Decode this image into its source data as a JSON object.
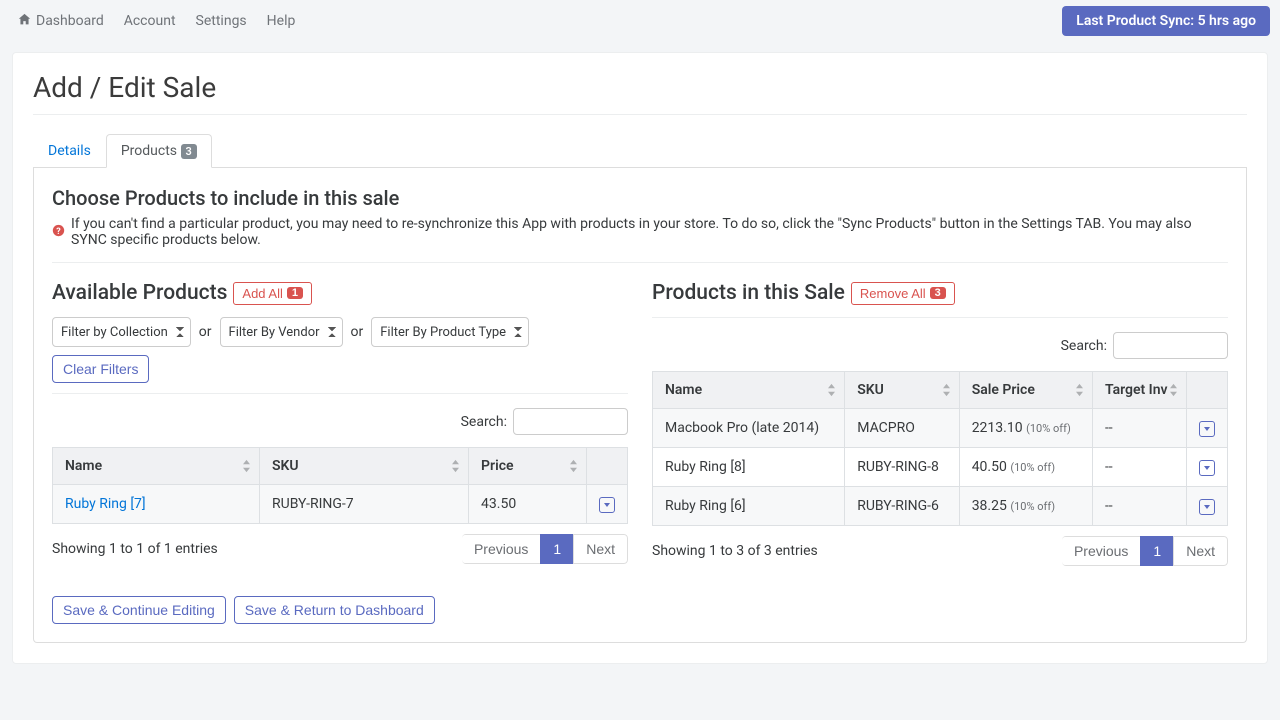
{
  "nav": {
    "dashboard": "Dashboard",
    "account": "Account",
    "settings": "Settings",
    "help": "Help",
    "sync_badge": "Last Product Sync: 5 hrs ago"
  },
  "page": {
    "title": "Add / Edit Sale"
  },
  "tabs": {
    "details": "Details",
    "products": "Products",
    "products_count": "3"
  },
  "instructions": {
    "heading": "Choose Products to include in this sale",
    "info": "If you can't find a particular product, you may need to re-synchronize this App with products in your store. To do so, click the \"Sync Products\" button in the Settings TAB. You may also SYNC specific products below."
  },
  "available": {
    "title": "Available Products",
    "add_all": "Add All",
    "add_all_count": "1",
    "filter_collection": "Filter by Collection",
    "filter_vendor": "Filter By Vendor",
    "filter_type": "Filter By Product Type",
    "clear_filters": "Clear Filters",
    "or": "or",
    "search_label": "Search:",
    "columns": {
      "name": "Name",
      "sku": "SKU",
      "price": "Price"
    },
    "rows": [
      {
        "name": "Ruby Ring [7]",
        "sku": "RUBY-RING-7",
        "price": "43.50"
      }
    ],
    "showing": "Showing 1 to 1 of 1 entries",
    "prev": "Previous",
    "page": "1",
    "next": "Next"
  },
  "inSale": {
    "title": "Products in this Sale",
    "remove_all": "Remove All",
    "remove_all_count": "3",
    "search_label": "Search:",
    "columns": {
      "name": "Name",
      "sku": "SKU",
      "sale_price": "Sale Price",
      "target_inv": "Target Inv"
    },
    "rows": [
      {
        "name": "Macbook Pro (late 2014)",
        "sku": "MACPRO",
        "sale_price": "2213.10",
        "discount": "(10% off)",
        "target_inv": "--"
      },
      {
        "name": "Ruby Ring [8]",
        "sku": "RUBY-RING-8",
        "sale_price": "40.50",
        "discount": "(10% off)",
        "target_inv": "--"
      },
      {
        "name": "Ruby Ring [6]",
        "sku": "RUBY-RING-6",
        "sale_price": "38.25",
        "discount": "(10% off)",
        "target_inv": "--"
      }
    ],
    "showing": "Showing 1 to 3 of 3 entries",
    "prev": "Previous",
    "page": "1",
    "next": "Next"
  },
  "footer": {
    "save_continue": "Save & Continue Editing",
    "save_return": "Save & Return to Dashboard"
  }
}
